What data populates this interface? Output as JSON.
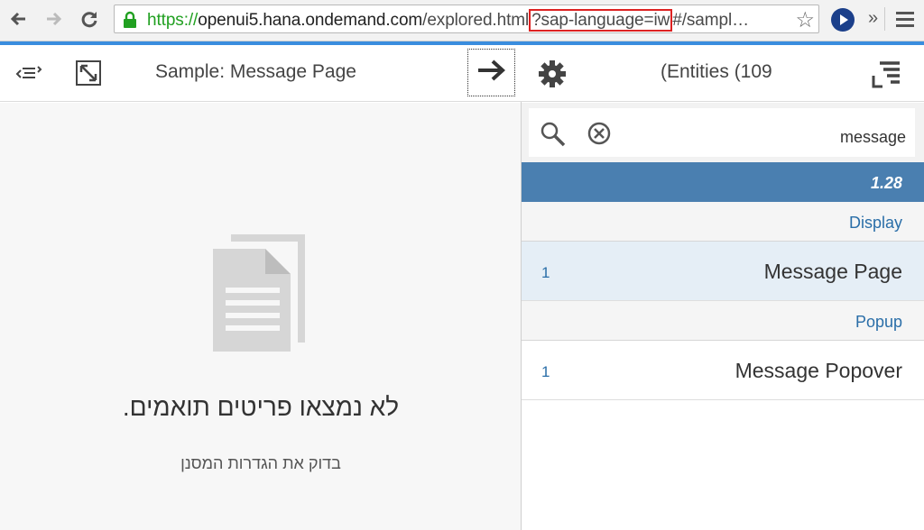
{
  "browser": {
    "url_scheme": "https://",
    "url_host": "openui5.hana.ondemand.com",
    "url_path": "/explored.html",
    "url_query_highlight": "?sap-language=iw",
    "url_rest": "#/sampl…",
    "more_extensions": "»",
    "icons": [
      "back-arrow-icon",
      "forward-arrow-icon",
      "reload-icon",
      "lock-icon",
      "star-icon",
      "extension-icon",
      "menu-icon"
    ]
  },
  "left_header": {
    "title": "Sample: Message Page",
    "icons": [
      "code-toggle-icon",
      "fullscreen-icon",
      "arrow-right-icon"
    ]
  },
  "right_header": {
    "title": "(Entities (109",
    "icons": [
      "settings-icon",
      "sort-list-icon"
    ]
  },
  "search": {
    "value": "message",
    "icons": [
      "search-icon",
      "clear-icon"
    ]
  },
  "version": "1.28",
  "groups": [
    {
      "header": "Display",
      "items": [
        {
          "title": "Message Page",
          "count": "1",
          "selected": true
        }
      ]
    },
    {
      "header": "Popup",
      "items": [
        {
          "title": "Message Popover",
          "count": "1",
          "selected": false
        }
      ]
    }
  ],
  "message_page": {
    "icon": "document-icon",
    "text": "לא נמצאו פריטים תואמים.",
    "description": "בדוק את הגדרות המסנן"
  },
  "colors": {
    "accent_blue": "#3a8dde",
    "version_bar": "#4a7fb0",
    "selected_row": "#e5eef6",
    "link_blue": "#2a6ea8"
  }
}
